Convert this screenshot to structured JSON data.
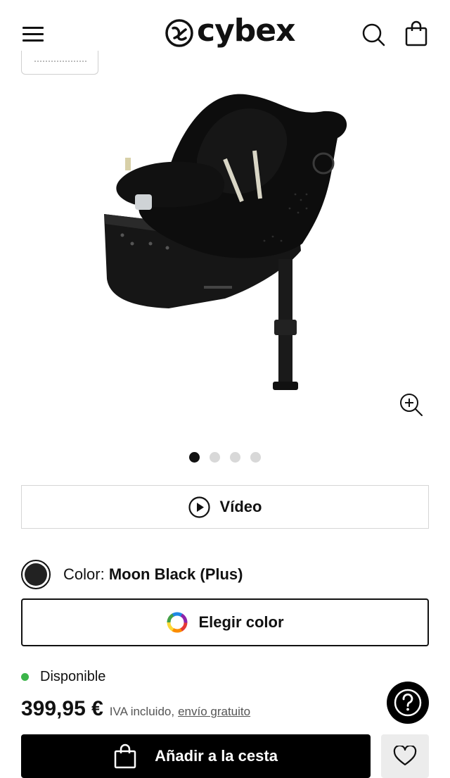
{
  "header": {
    "brand": "cybex",
    "menu_icon": "hamburger-menu-icon",
    "search_icon": "search-icon",
    "cart_icon": "shopping-bag-icon"
  },
  "gallery": {
    "image_alt": "Moon Black (Plus)",
    "zoom_icon": "zoom-in-icon",
    "page_count": 4,
    "active_page": 1
  },
  "video": {
    "label": "Vídeo",
    "icon": "play-icon"
  },
  "color": {
    "prefix": "Color:",
    "value": "Moon Black (Plus)",
    "swatch_color": "#222222"
  },
  "choose_color": {
    "label": "Elegir color",
    "icon": "color-wheel-icon"
  },
  "availability": {
    "label": "Disponible",
    "status_color": "#3bb54a"
  },
  "pricing": {
    "price": "399,95 €",
    "tax_note": "IVA incluido,",
    "shipping": "envío gratuito"
  },
  "help": {
    "icon": "help-question-icon"
  },
  "add_to_cart": {
    "label": "Añadir a la cesta",
    "icon": "shopping-bag-icon"
  },
  "wishlist": {
    "icon": "heart-icon"
  }
}
